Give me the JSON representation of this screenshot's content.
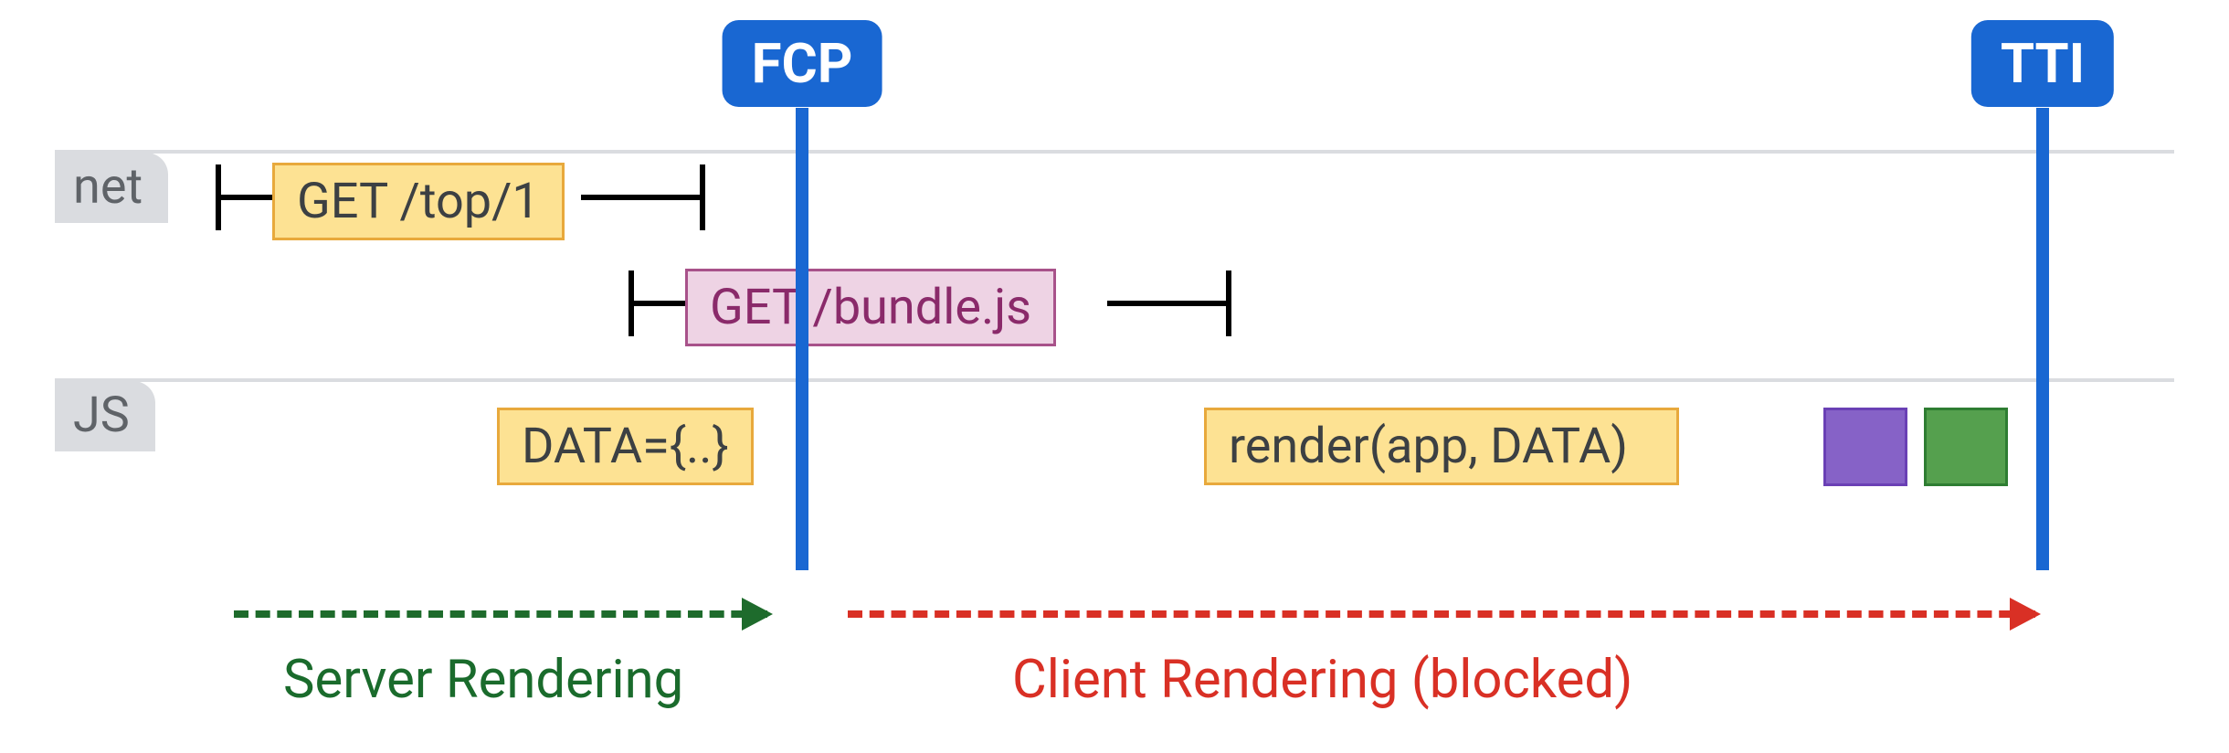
{
  "markers": {
    "fcp": "FCP",
    "tti": "TTI"
  },
  "tracks": {
    "net": "net",
    "js": "JS"
  },
  "net": {
    "req1": "GET /top/1",
    "req2": "GET /bundle.js"
  },
  "js": {
    "data": "DATA={..}",
    "render": "render(app, DATA)"
  },
  "phases": {
    "server": "Server Rendering",
    "client": "Client Rendering (blocked)"
  },
  "colors": {
    "blue": "#1967d2",
    "yellow_bg": "#fde293",
    "yellow_border": "#e8a93c",
    "pink_bg": "#eed3e4",
    "pink_border": "#a8528a",
    "purple": "#8662c7",
    "green_box": "#55a04e",
    "green_arrow": "#1e6b2c",
    "red": "#d93025",
    "grey": "#dadce0"
  },
  "chart_data": {
    "type": "timeline",
    "x_unit": "relative-time",
    "markers": [
      {
        "name": "FCP",
        "x": 0.36
      },
      {
        "name": "TTI",
        "x": 0.92
      }
    ],
    "tracks": [
      {
        "name": "net",
        "spans": [
          {
            "label": "GET /top/1",
            "start": 0.09,
            "end": 0.32,
            "color": "yellow"
          },
          {
            "label": "GET /bundle.js",
            "start": 0.28,
            "end": 0.56,
            "color": "pink"
          }
        ]
      },
      {
        "name": "JS",
        "spans": [
          {
            "label": "DATA={..}",
            "start": 0.22,
            "end": 0.36,
            "color": "yellow"
          },
          {
            "label": "render(app, DATA)",
            "start": 0.54,
            "end": 0.84,
            "color": "yellow"
          },
          {
            "label": "purple-task",
            "start": 0.84,
            "end": 0.88,
            "color": "purple"
          },
          {
            "label": "green-task",
            "start": 0.885,
            "end": 0.925,
            "color": "green"
          }
        ]
      }
    ],
    "phases": [
      {
        "label": "Server Rendering",
        "start": 0.1,
        "end": 0.35,
        "color": "green"
      },
      {
        "label": "Client Rendering (blocked)",
        "start": 0.38,
        "end": 0.92,
        "color": "red"
      }
    ]
  }
}
